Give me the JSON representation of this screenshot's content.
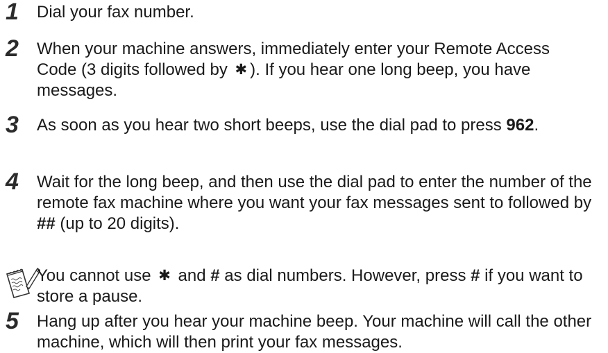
{
  "steps": [
    {
      "number": "1",
      "text": "Dial your fax number."
    },
    {
      "number": "2",
      "text_before_star": "When your machine answers, immediately enter your Remote Access Code (3 digits followed by",
      "star_symbol": "✱",
      "text_after_star": "). If you hear one long beep, you have messages."
    },
    {
      "number": "3",
      "text": "As soon as you hear two short beeps, use the dial pad to press",
      "code": "962",
      "text_end": "."
    },
    {
      "number": "4",
      "text": "Wait for the long beep, and then use the dial pad to enter the number of the remote fax machine where you want your fax messages sent to followed by",
      "code": "##",
      "text_end": "(up to 20 digits)."
    },
    {
      "number": "5",
      "text": "Hang up after you hear your machine beep. Your machine will call the other machine, which will then print your fax messages."
    }
  ],
  "note": {
    "icon": "note-pad-pencil-icon",
    "part1": "You cannot use",
    "star_symbol": "✱",
    "part2": "and",
    "hash1": "#",
    "part3": "as dial numbers. However, press",
    "hash2": "#",
    "part4": "if you want to store a pause."
  }
}
